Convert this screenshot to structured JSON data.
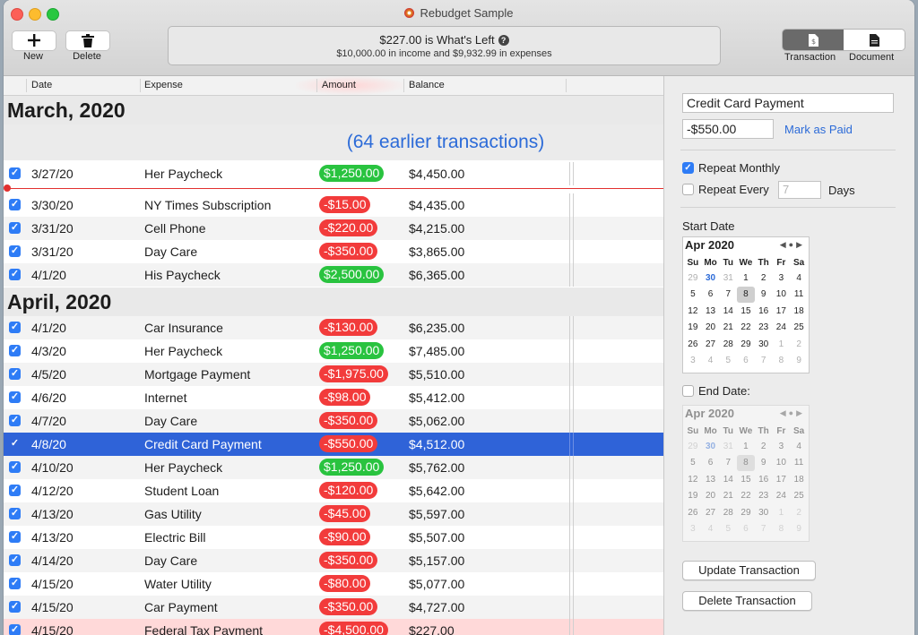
{
  "window": {
    "title": "Rebudget Sample"
  },
  "toolbar": {
    "new_label": "New",
    "delete_label": "Delete",
    "transaction_label": "Transaction",
    "document_label": "Document"
  },
  "summary": {
    "main": "$227.00 is What's Left",
    "sub": "$10,000.00 in income and $9,932.99 in expenses"
  },
  "columns": {
    "date": "Date",
    "expense": "Expense",
    "amount": "Amount",
    "balance": "Balance"
  },
  "list": {
    "march_header": "March, 2020",
    "earlier": "(64 earlier transactions)",
    "april_header": "April, 2020",
    "rows": [
      {
        "date": "3/27/20",
        "name": "Her Paycheck",
        "amount": "$1,250.00",
        "balance": "$4,450.00"
      },
      {
        "date": "3/30/20",
        "name": "NY Times Subscription",
        "amount": "-$15.00",
        "balance": "$4,435.00"
      },
      {
        "date": "3/31/20",
        "name": "Cell Phone",
        "amount": "-$220.00",
        "balance": "$4,215.00"
      },
      {
        "date": "3/31/20",
        "name": "Day Care",
        "amount": "-$350.00",
        "balance": "$3,865.00"
      },
      {
        "date": "4/1/20",
        "name": "His Paycheck",
        "amount": "$2,500.00",
        "balance": "$6,365.00"
      },
      {
        "date": "4/1/20",
        "name": "Car Insurance",
        "amount": "-$130.00",
        "balance": "$6,235.00"
      },
      {
        "date": "4/3/20",
        "name": "Her Paycheck",
        "amount": "$1,250.00",
        "balance": "$7,485.00"
      },
      {
        "date": "4/5/20",
        "name": "Mortgage Payment",
        "amount": "-$1,975.00",
        "balance": "$5,510.00"
      },
      {
        "date": "4/6/20",
        "name": "Internet",
        "amount": "-$98.00",
        "balance": "$5,412.00"
      },
      {
        "date": "4/7/20",
        "name": "Day Care",
        "amount": "-$350.00",
        "balance": "$5,062.00"
      },
      {
        "date": "4/8/20",
        "name": "Credit Card Payment",
        "amount": "-$550.00",
        "balance": "$4,512.00"
      },
      {
        "date": "4/10/20",
        "name": "Her Paycheck",
        "amount": "$1,250.00",
        "balance": "$5,762.00"
      },
      {
        "date": "4/12/20",
        "name": "Student Loan",
        "amount": "-$120.00",
        "balance": "$5,642.00"
      },
      {
        "date": "4/13/20",
        "name": "Gas Utility",
        "amount": "-$45.00",
        "balance": "$5,597.00"
      },
      {
        "date": "4/13/20",
        "name": "Electric Bill",
        "amount": "-$90.00",
        "balance": "$5,507.00"
      },
      {
        "date": "4/14/20",
        "name": "Day Care",
        "amount": "-$350.00",
        "balance": "$5,157.00"
      },
      {
        "date": "4/15/20",
        "name": "Water Utility",
        "amount": "-$80.00",
        "balance": "$5,077.00"
      },
      {
        "date": "4/15/20",
        "name": "Car Payment",
        "amount": "-$350.00",
        "balance": "$4,727.00"
      },
      {
        "date": "4/15/20",
        "name": "Federal Tax Payment",
        "amount": "-$4,500.00",
        "balance": "$227.00"
      }
    ]
  },
  "detail": {
    "name_value": "Credit Card Payment",
    "amount_value": "-$550.00",
    "mark_paid": "Mark as Paid",
    "repeat_monthly": "Repeat Monthly",
    "repeat_every": "Repeat Every",
    "repeat_days_placeholder": "7",
    "days": "Days",
    "start_date": "Start Date",
    "end_date": "End Date:",
    "update_button": "Update Transaction",
    "delete_button": "Delete Transaction"
  },
  "calendar": {
    "title": "Apr 2020",
    "weekdays": [
      "Su",
      "Mo",
      "Tu",
      "We",
      "Th",
      "Fr",
      "Sa"
    ],
    "weeks": [
      [
        "29",
        "30",
        "31",
        "1",
        "2",
        "3",
        "4"
      ],
      [
        "5",
        "6",
        "7",
        "8",
        "9",
        "10",
        "11"
      ],
      [
        "12",
        "13",
        "14",
        "15",
        "16",
        "17",
        "18"
      ],
      [
        "19",
        "20",
        "21",
        "22",
        "23",
        "24",
        "25"
      ],
      [
        "26",
        "27",
        "28",
        "29",
        "30",
        "1",
        "2"
      ],
      [
        "3",
        "4",
        "5",
        "6",
        "7",
        "8",
        "9"
      ]
    ]
  }
}
